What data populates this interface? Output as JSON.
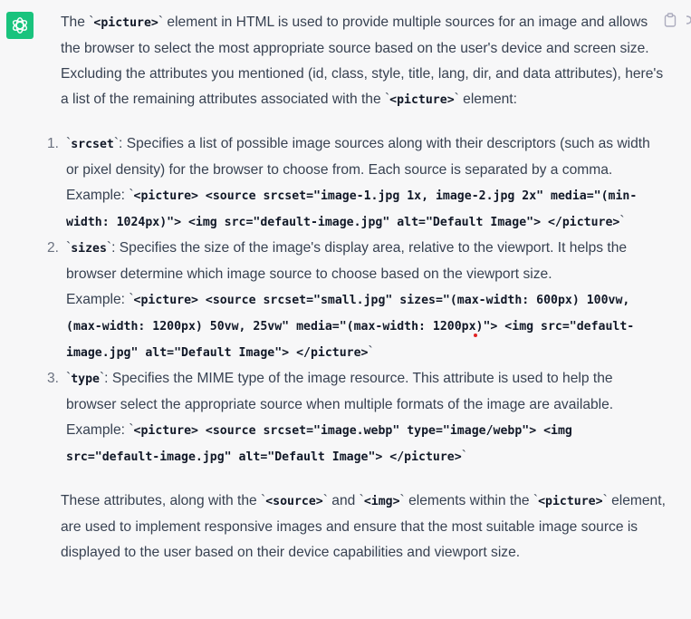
{
  "avatar": {
    "icon": "openai-logo-icon",
    "color": "#19c37d"
  },
  "intro": {
    "t1": "The `",
    "code1": "<picture>",
    "t2": "` element in HTML is used to provide multiple sources for an image and allows the browser to select the most appropriate source based on the user's device and screen size. Excluding the attributes you mentioned (id, class, style, title, lang, dir, and data attributes), here's a list of the remaining attributes associated with the `",
    "code2": "<picture>",
    "t3": "` element:"
  },
  "items": [
    {
      "number": "1.",
      "tick_open": "`",
      "name": "srcset",
      "desc": "`: Specifies a list of possible image sources along with their descriptors (such as width or pixel density) for the browser to choose from. Each source is separated by a comma.",
      "example_label": "Example: `",
      "example_code": "<picture> <source srcset=\"image-1.jpg 1x, image-2.jpg 2x\" media=\"(min-width: 1024px)\"> <img src=\"default-image.jpg\" alt=\"Default Image\"> </picture>",
      "example_end": "`"
    },
    {
      "number": "2.",
      "tick_open": "`",
      "name": "sizes",
      "desc": "`: Specifies the size of the image's display area, relative to the viewport. It helps the browser determine which image source to choose based on the viewport size.",
      "example_label": "Example: `",
      "example_code": "<picture> <source srcset=\"small.jpg\" sizes=\"(max-width: 600px) 100vw, (max-width: 1200px) 50vw, 25vw\" media=\"(max-width: 1200px)\"> <img src=\"default-image.jpg\" alt=\"Default Image\"> </picture>",
      "example_end": "`"
    },
    {
      "number": "3.",
      "tick_open": "`",
      "name": "type",
      "desc": "`: Specifies the MIME type of the image resource. This attribute is used to help the browser select the appropriate source when multiple formats of the image are available.",
      "example_label": "Example: `",
      "example_code": "<picture> <source srcset=\"image.webp\" type=\"image/webp\"> <img src=\"default-image.jpg\" alt=\"Default Image\"> </picture>",
      "example_end": "`"
    }
  ],
  "outro": {
    "t1": "These attributes, along with the `",
    "code1": "<source>",
    "t2": "` and `",
    "code2": "<img>",
    "t3": "` elements within the `",
    "code3": "<picture>",
    "t4": "` element, are used to implement responsive images and ensure that the most suitable image source is displayed to the user based on their device capabilities and viewport size."
  },
  "actions": {
    "copy_icon": "clipboard-icon",
    "more_icon": "partial-icon"
  }
}
